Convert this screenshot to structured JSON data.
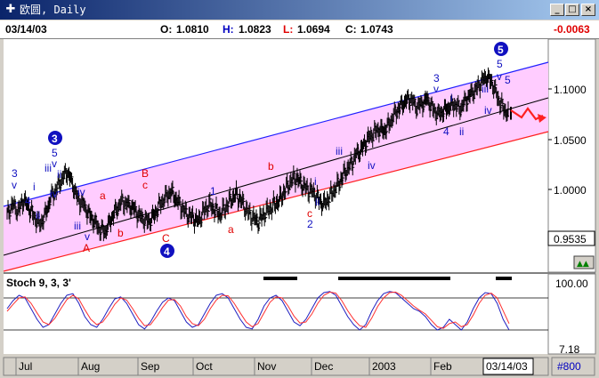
{
  "window": {
    "title": "欧圆, Daily",
    "icon": "chart-app-icon",
    "buttons": {
      "minimize": "_",
      "maximize": "□",
      "close": "×"
    }
  },
  "info": {
    "date": "03/14/03",
    "open_label": "O:",
    "open": "1.0810",
    "high_label": "H:",
    "high": "1.0823",
    "low_label": "L:",
    "low": "1.0694",
    "close_label": "C:",
    "close": "1.0743",
    "change": "-0.0063"
  },
  "colors": {
    "channel_fill": "#ffccff",
    "channel_upper": "#2020ff",
    "channel_lower": "#ff2020",
    "stoch_k": "#2020c0",
    "stoch_d": "#ff3030",
    "wave_blue": "#1010c0",
    "wave_red": "#e00000"
  },
  "price_axis": {
    "ticks": [
      "1.1000",
      "1.0500",
      "1.0000"
    ],
    "current": "0.9535"
  },
  "stoch": {
    "label": "Stoch 9, 3, 3'",
    "ticks": [
      "100.00",
      "7.18"
    ]
  },
  "time_axis": {
    "labels": [
      "Jul",
      "Aug",
      "Sep",
      "Oct",
      "Nov",
      "Dec",
      "2003",
      "Feb"
    ],
    "current_date": "03/14/03",
    "bar_count": "#800"
  },
  "waves": [
    {
      "t": "3",
      "c": "b"
    },
    {
      "t": "v",
      "c": "b"
    },
    {
      "t": "4",
      "c": "b"
    },
    {
      "t": "ii",
      "c": "b"
    },
    {
      "t": "i",
      "c": "b"
    },
    {
      "t": "iii",
      "c": "b"
    },
    {
      "t": "5",
      "c": "b"
    },
    {
      "t": "v",
      "c": "b"
    },
    {
      "t": "ii",
      "c": "b"
    },
    {
      "t": "iv",
      "c": "b"
    },
    {
      "t": "iv",
      "c": "b"
    },
    {
      "t": "iii",
      "c": "b"
    },
    {
      "t": "v",
      "c": "b"
    },
    {
      "t": "a",
      "c": "r"
    },
    {
      "t": "b",
      "c": "r"
    },
    {
      "t": "A",
      "c": "r"
    },
    {
      "t": "B",
      "c": "r"
    },
    {
      "t": "c",
      "c": "r"
    },
    {
      "t": "C",
      "c": "r"
    },
    {
      "t": "1",
      "c": "b"
    },
    {
      "t": "a",
      "c": "r"
    },
    {
      "t": "b",
      "c": "r"
    },
    {
      "t": "i",
      "c": "b"
    },
    {
      "t": "ii",
      "c": "b"
    },
    {
      "t": "c",
      "c": "r"
    },
    {
      "t": "2",
      "c": "b"
    },
    {
      "t": "iii",
      "c": "b"
    },
    {
      "t": "iv",
      "c": "b"
    },
    {
      "t": "3",
      "c": "b"
    },
    {
      "t": "v",
      "c": "b"
    },
    {
      "t": "i",
      "c": "b"
    },
    {
      "t": "4",
      "c": "b"
    },
    {
      "t": "ii",
      "c": "b"
    },
    {
      "t": "iii",
      "c": "b"
    },
    {
      "t": "iv",
      "c": "b"
    },
    {
      "t": "v",
      "c": "b"
    },
    {
      "t": "5",
      "c": "b"
    },
    {
      "t": "5",
      "c": "b"
    }
  ],
  "circled_waves": [
    "3",
    "4",
    "5"
  ],
  "chart_data": {
    "type": "line",
    "title": "欧圆, Daily",
    "price": {
      "y_ticks": [
        1.1,
        1.05,
        1.0
      ],
      "ylim": [
        0.93,
        1.145
      ],
      "x_labels": [
        "Jul",
        "Aug",
        "Sep",
        "Oct",
        "Nov",
        "Dec",
        "2003",
        "Feb"
      ],
      "close_path": [
        0.975,
        0.985,
        0.978,
        0.99,
        0.982,
        0.972,
        0.965,
        0.975,
        0.992,
        1.0,
        1.01,
        1.018,
        1.005,
        0.99,
        0.985,
        0.975,
        0.968,
        0.96,
        0.958,
        0.97,
        0.98,
        0.988,
        0.985,
        0.982,
        0.975,
        0.97,
        0.968,
        0.975,
        0.985,
        0.992,
        0.998,
        0.99,
        0.982,
        0.975,
        0.972,
        0.968,
        0.978,
        0.985,
        0.98,
        0.975,
        0.982,
        0.99,
        0.995,
        0.988,
        0.978,
        0.972,
        0.968,
        0.975,
        0.98,
        0.985,
        0.99,
        1.0,
        1.008,
        1.012,
        1.005,
        1.0,
        0.998,
        0.99,
        0.985,
        0.992,
        1.0,
        1.008,
        1.018,
        1.025,
        1.035,
        1.04,
        1.05,
        1.055,
        1.06,
        1.058,
        1.065,
        1.075,
        1.082,
        1.088,
        1.09,
        1.082,
        1.085,
        1.09,
        1.08,
        1.075,
        1.078,
        1.082,
        1.085,
        1.08,
        1.088,
        1.095,
        1.1,
        1.108,
        1.112,
        1.105,
        1.09,
        1.08,
        1.0743
      ]
    },
    "stoch": {
      "label": "Stoch 9, 3, 3'",
      "ylim": [
        0,
        100
      ],
      "levels": [
        80,
        20
      ],
      "k": [
        60,
        75,
        85,
        80,
        60,
        40,
        25,
        30,
        50,
        70,
        85,
        88,
        70,
        45,
        30,
        25,
        40,
        60,
        78,
        82,
        70,
        50,
        30,
        22,
        35,
        55,
        72,
        80,
        75,
        55,
        35,
        25,
        30,
        50,
        70,
        85,
        88,
        80,
        60,
        40,
        25,
        22,
        40,
        65,
        80,
        85,
        75,
        55,
        35,
        28,
        40,
        60,
        80,
        90,
        92,
        85,
        65,
        45,
        30,
        20,
        30,
        55,
        75,
        88,
        92,
        90,
        80,
        70,
        60,
        55,
        45,
        30,
        20,
        25,
        40,
        30,
        20,
        35,
        60,
        80,
        90,
        88,
        70,
        40,
        20
      ],
      "d": [
        55,
        68,
        80,
        82,
        70,
        52,
        35,
        30,
        42,
        60,
        77,
        85,
        78,
        58,
        40,
        30,
        35,
        50,
        68,
        80,
        76,
        60,
        42,
        28,
        30,
        45,
        62,
        76,
        77,
        65,
        45,
        32,
        28,
        40,
        60,
        76,
        85,
        84,
        70,
        52,
        35,
        26,
        32,
        52,
        72,
        82,
        80,
        65,
        46,
        33,
        35,
        50,
        70,
        85,
        91,
        89,
        75,
        56,
        40,
        28,
        25,
        42,
        64,
        80,
        90,
        91,
        85,
        75,
        65,
        57,
        50,
        38,
        26,
        23,
        32,
        35,
        26,
        30,
        48,
        70,
        85,
        89,
        80,
        56,
        32
      ]
    }
  }
}
